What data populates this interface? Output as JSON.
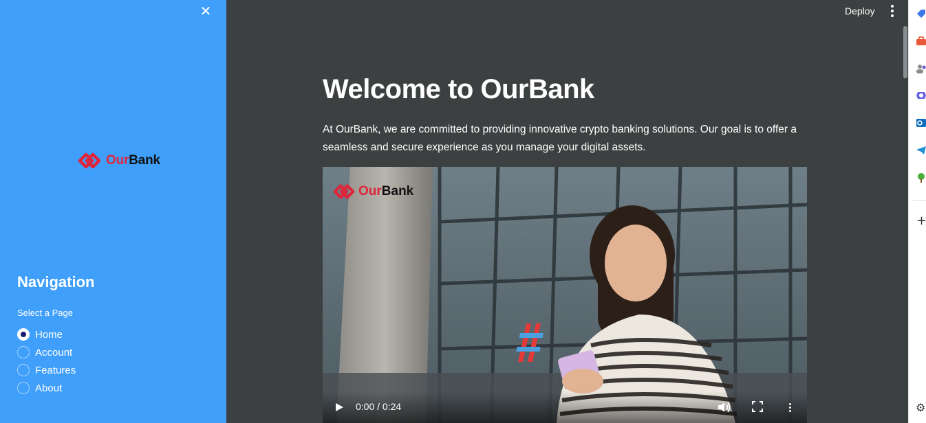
{
  "sidebar": {
    "close_label": "✕",
    "logo": {
      "our": "Our",
      "bank": "Bank"
    },
    "nav_title": "Navigation",
    "select_label": "Select a Page",
    "options": [
      "Home",
      "Account",
      "Features",
      "About"
    ],
    "selected": "Home"
  },
  "topbar": {
    "deploy_label": "Deploy"
  },
  "main": {
    "title": "Welcome to OurBank",
    "intro": "At OurBank, we are committed to providing innovative crypto banking solutions. Our goal is to offer a seamless and secure experience as you manage your digital assets."
  },
  "video": {
    "logo": {
      "our": "Our",
      "bank": "Bank"
    },
    "time": "0:00 / 0:24",
    "progress": 0
  },
  "edge_sidebar": {
    "icons": [
      "tag-icon",
      "briefcase-icon",
      "people-icon",
      "copilot-icon",
      "outlook-icon",
      "telegram-icon",
      "tree-icon"
    ],
    "plus_label": "+",
    "gear_label": "⚙"
  },
  "colors": {
    "sidebar_bg": "#3f9ffb",
    "main_bg": "#3d4041",
    "brand_red": "#e0253a",
    "radio_selected": "#1a1a6e"
  }
}
